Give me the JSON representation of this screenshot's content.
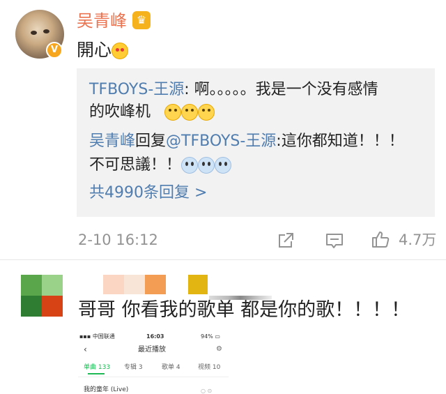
{
  "post": {
    "username": "吴青峰",
    "crown_icon": "crown-icon",
    "verified_icon": "verified-badge-icon",
    "verified_label": "V",
    "content_text": "開心",
    "content_emoji": "heart-eyes-emoji",
    "reply_box": {
      "line1_author": "TFBOYS-王源",
      "line1_text": ": 啊。。。。。我是一个没有感情",
      "line2_text": "的吹峰机",
      "line2_emoji": "grimacing-emoji",
      "line3_author": "吴青峰",
      "line3_reply": "回复",
      "line3_mention": "@TFBOYS-王源",
      "line3_text": ":這你都知道！！！",
      "line4_text": "不可思議！！",
      "line4_emoji": "screaming-emoji",
      "more_label": "共4990条回复 >"
    },
    "timestamp": "2-10 16:12",
    "likes": "4.7万"
  },
  "comment2": {
    "text": "哥哥 你看我的歌单 都是你的歌！！！！",
    "screenshot": {
      "carrier": "中国联通",
      "clock": "16:03",
      "battery": "94%",
      "title": "最近播放",
      "tabs": [
        "单曲 133",
        "专辑 3",
        "歌单 4",
        "视频 10"
      ],
      "first_row": "我的童年 (Live)"
    }
  },
  "colors": {
    "username": "#eb7350",
    "link": "#507daf",
    "meta": "#939393",
    "reply_bg": "#f2f2f2",
    "accent_green": "#1db954"
  }
}
